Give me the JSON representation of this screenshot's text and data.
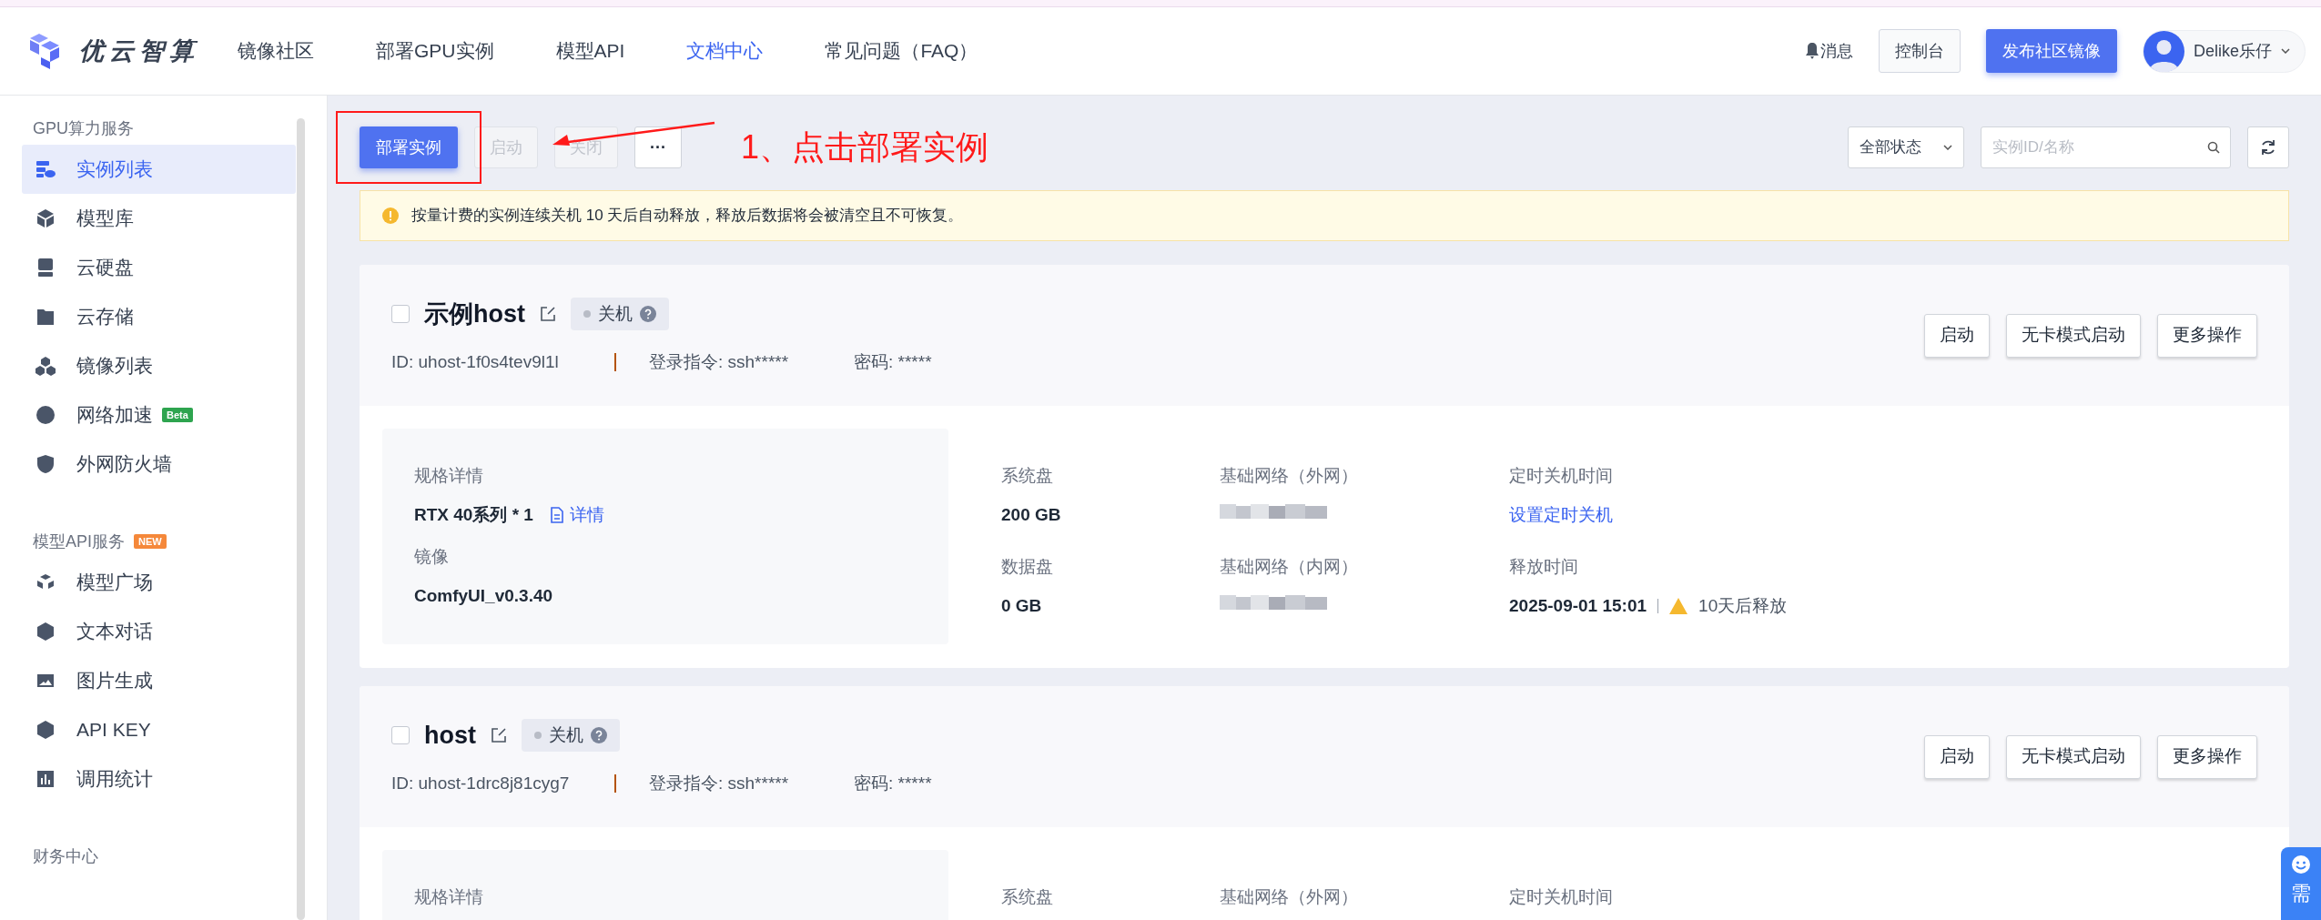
{
  "header": {
    "logo_text": "优云智算",
    "nav": [
      {
        "label": "镜像社区",
        "selected": false
      },
      {
        "label": "部署GPU实例",
        "selected": false
      },
      {
        "label": "模型API",
        "selected": false
      },
      {
        "label": "文档中心",
        "selected": true
      },
      {
        "label": "常见问题（FAQ）",
        "selected": false
      }
    ],
    "messages": "消息",
    "console": "控制台",
    "publish": "发布社区镜像",
    "user": "Delike乐仔"
  },
  "sidebar": {
    "sections": [
      {
        "title": "GPU算力服务",
        "items": [
          {
            "label": "实例列表",
            "selected": true
          },
          {
            "label": "模型库",
            "selected": false
          },
          {
            "label": "云硬盘",
            "selected": false
          },
          {
            "label": "云存储",
            "selected": false
          },
          {
            "label": "镜像列表",
            "selected": false
          },
          {
            "label": "网络加速",
            "selected": false,
            "badge": "Beta"
          },
          {
            "label": "外网防火墙",
            "selected": false
          }
        ]
      },
      {
        "title": "模型API服务",
        "badge": "NEW",
        "items": [
          {
            "label": "模型广场",
            "selected": false
          },
          {
            "label": "文本对话",
            "selected": false
          },
          {
            "label": "图片生成",
            "selected": false
          },
          {
            "label": "API KEY",
            "selected": false
          },
          {
            "label": "调用统计",
            "selected": false
          }
        ]
      },
      {
        "title": "财务中心"
      }
    ]
  },
  "toolbar": {
    "buttons": [
      {
        "label": "部署实例",
        "kind": "primary"
      },
      {
        "label": "启动",
        "kind": "disabled"
      },
      {
        "label": "关闭",
        "kind": "disabled"
      },
      {
        "label": "···",
        "kind": "plain"
      }
    ],
    "status_filter": "全部状态",
    "search_placeholder": "实例ID/名称"
  },
  "annotation": {
    "text": "1、点击部署实例"
  },
  "alert": "按量计费的实例连续关机 10 天后自动释放，释放后数据将会被清空且不可恢复。",
  "instances": [
    {
      "name": "示例host",
      "checked": false,
      "status": "关机",
      "id": "ID: uhost-1f0s4tev9l1l",
      "login": "登录指令: ssh*****",
      "password": "密码: *****",
      "actions": [
        "启动",
        "无卡模式启动",
        "更多操作"
      ],
      "spec_box": [
        {
          "label": "规格详情",
          "value": "RTX 40系列 * 1",
          "link": "详情"
        },
        {
          "label": "镜像",
          "value": "ComfyUI_v0.3.40"
        }
      ],
      "columns": [
        [
          {
            "label": "系统盘",
            "kind": "text",
            "value": "200 GB"
          },
          {
            "label": "数据盘",
            "kind": "text",
            "value": "0 GB"
          }
        ],
        [
          {
            "label": "基础网络（外网）",
            "kind": "blurred"
          },
          {
            "label": "基础网络（内网）",
            "kind": "blurred"
          }
        ],
        [
          {
            "label": "定时关机时间",
            "kind": "link",
            "value": "设置定时关机"
          },
          {
            "label": "释放时间",
            "kind": "release",
            "value": "2025-09-01 15:01",
            "note": "10天后释放"
          }
        ]
      ]
    },
    {
      "name": "host",
      "checked": false,
      "status": "关机",
      "id": "ID: uhost-1drc8j81cyg7",
      "login": "登录指令: ssh*****",
      "password": "密码: *****",
      "actions": [
        "启动",
        "无卡模式启动",
        "更多操作"
      ],
      "spec_box": [
        {
          "label": "规格详情"
        }
      ],
      "columns": [
        [
          {
            "label": "系统盘"
          }
        ],
        [
          {
            "label": "基础网络（外网）"
          }
        ],
        [
          {
            "label": "定时关机时间"
          }
        ]
      ]
    }
  ],
  "help_widget": {
    "text": "需"
  }
}
